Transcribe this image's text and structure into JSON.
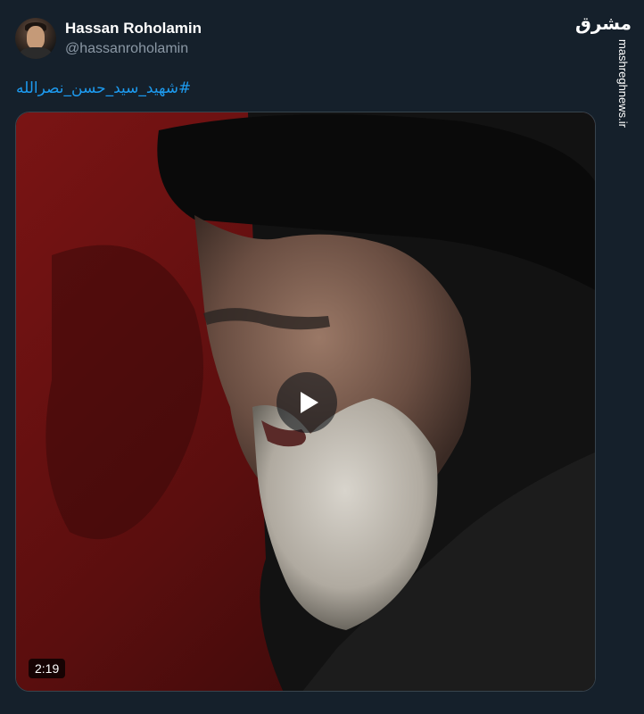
{
  "author": {
    "display_name": "Hassan Roholamin",
    "handle": "@hassanroholamin"
  },
  "tweet": {
    "hashtag": "#شهید_سید_حسن_نصرالله"
  },
  "watermark": {
    "logo": "مشرق",
    "site": "mashreghnews.ir"
  },
  "media": {
    "type": "video",
    "duration": "2:19",
    "play_icon": "play-icon"
  }
}
